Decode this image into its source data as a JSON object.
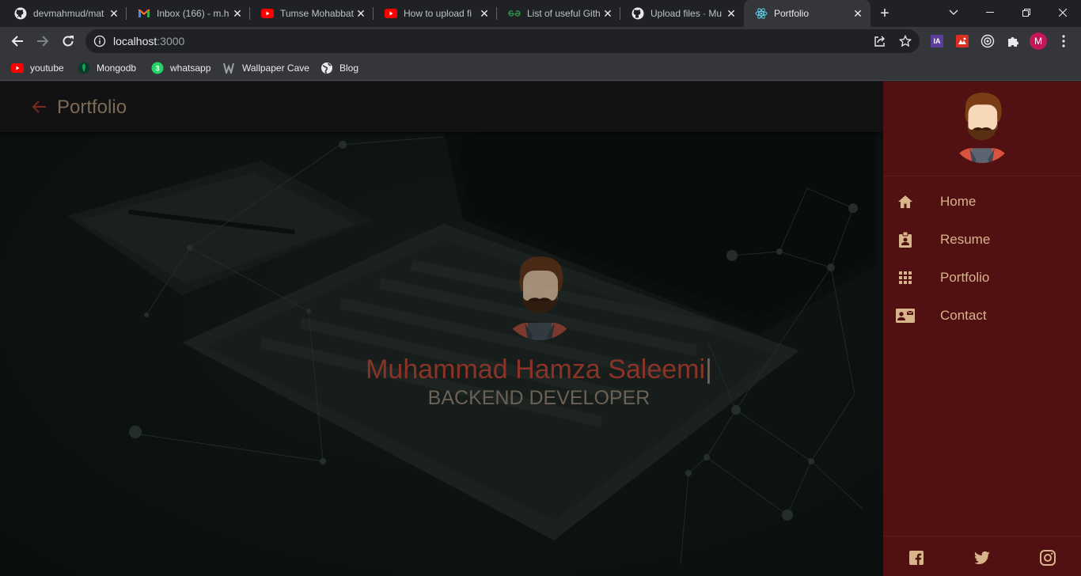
{
  "browser": {
    "tabs": [
      {
        "title": "devmahmud/mat",
        "icon": "github-icon"
      },
      {
        "title": "Inbox (166) - m.h",
        "icon": "gmail-icon"
      },
      {
        "title": "Tumse Mohabbat",
        "icon": "youtube-icon"
      },
      {
        "title": "How to upload fi",
        "icon": "youtube-icon"
      },
      {
        "title": "List of useful Gith",
        "icon": "geeksforgeeks-icon"
      },
      {
        "title": "Upload files · Mu",
        "icon": "github-icon"
      },
      {
        "title": "Portfolio",
        "icon": "react-icon",
        "active": true
      }
    ],
    "url_host": "localhost",
    "url_port": ":3000",
    "profile_initial": "M",
    "extension_label": "IA",
    "bookmarks": [
      {
        "label": "youtube",
        "icon": "youtube-icon"
      },
      {
        "label": "Mongodb",
        "icon": "mongodb-icon"
      },
      {
        "label": "whatsapp",
        "icon": "whatsapp-icon"
      },
      {
        "label": "Wallpaper Cave",
        "icon": "wallpaper-cave-icon"
      },
      {
        "label": "Blog",
        "icon": "globe-icon"
      }
    ]
  },
  "app": {
    "header_title": "Portfolio",
    "hero": {
      "name": "Muhammad Hamza Saleemi",
      "cursor": "|",
      "role": "BACKEND DEVELOPER"
    },
    "drawer": {
      "items": [
        {
          "label": "Home",
          "icon": "home-icon"
        },
        {
          "label": "Resume",
          "icon": "resume-badge-icon"
        },
        {
          "label": "Portfolio",
          "icon": "apps-grid-icon"
        },
        {
          "label": "Contact",
          "icon": "contact-mail-icon"
        }
      ],
      "social": [
        "facebook-icon",
        "twitter-icon",
        "instagram-icon"
      ]
    }
  },
  "colors": {
    "drawer_bg": "#511012",
    "drawer_text": "#d8b48a",
    "name_color": "#8a3326",
    "role_color": "#6b6156",
    "appbar_bg": "#121212"
  }
}
